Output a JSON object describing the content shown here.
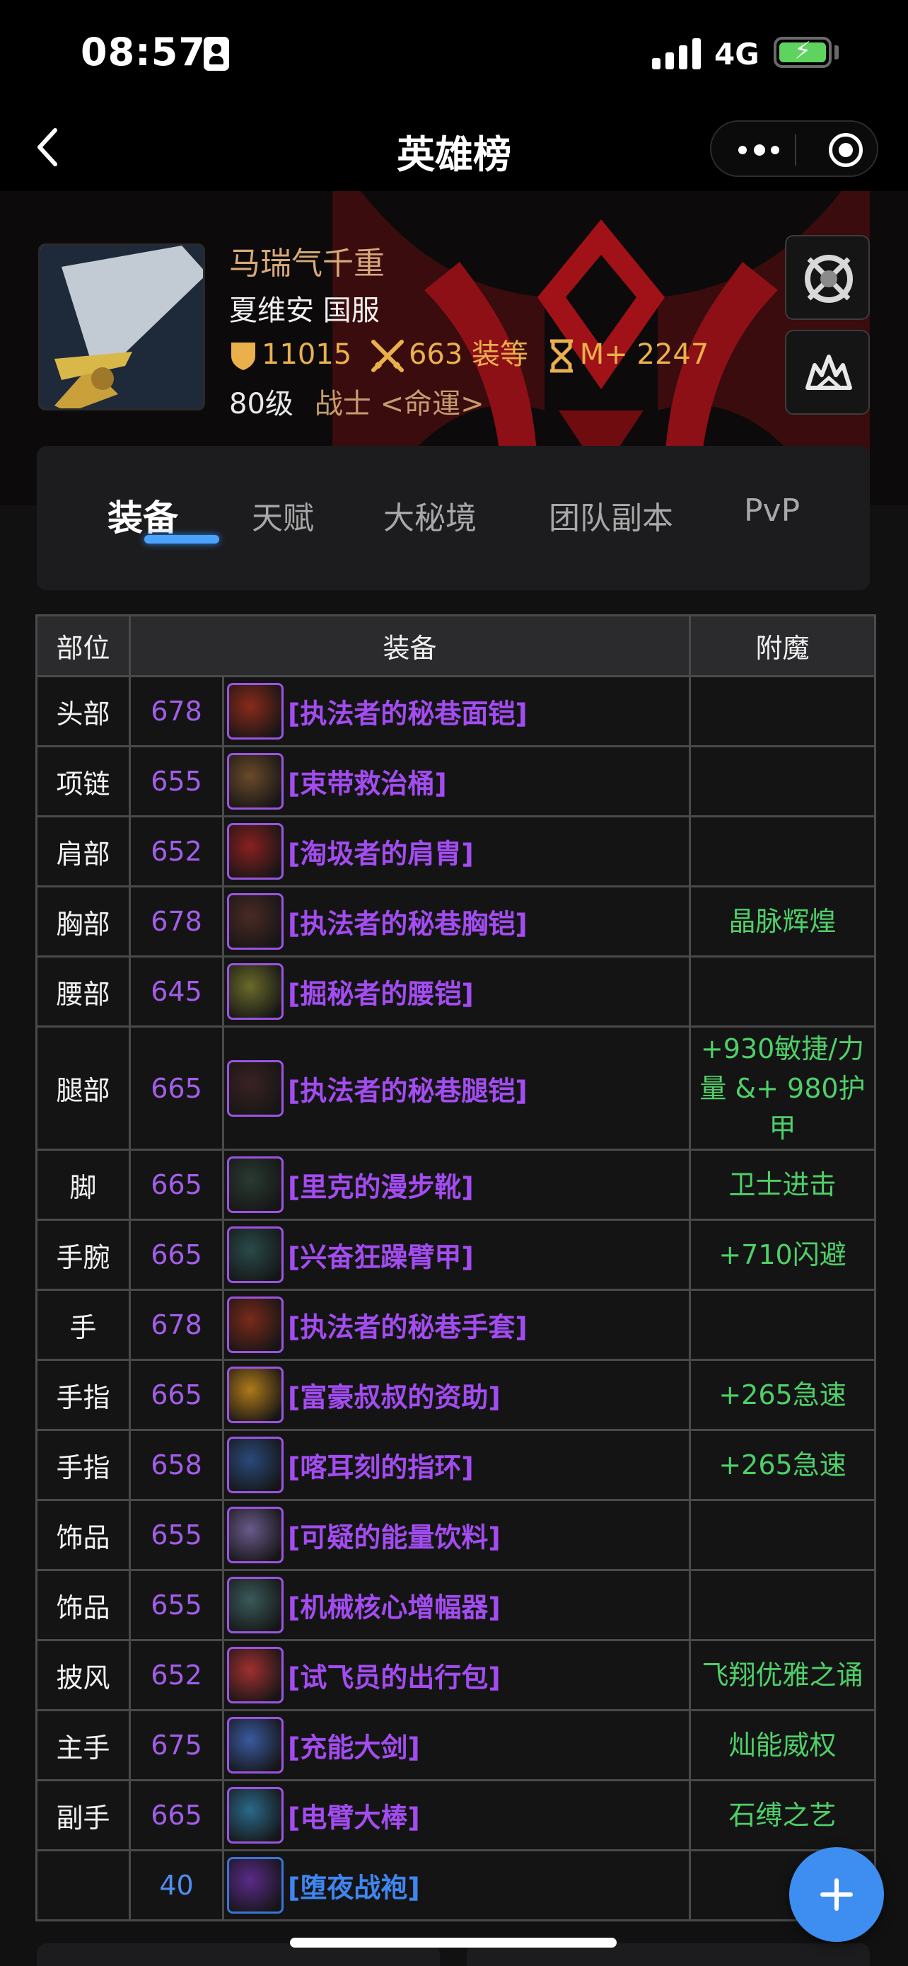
{
  "status_bar": {
    "time": "08:57",
    "network": "4G"
  },
  "nav": {
    "title": "英雄榜"
  },
  "profile": {
    "name": "马瑞气千重",
    "realm": "夏维安 国服",
    "achievement_points": "11015",
    "item_level": "663",
    "item_level_unit": "装等",
    "mythic_plus": "M+ 2247",
    "level": "80级",
    "class_guild": "战士 <命運>"
  },
  "tabs": [
    {
      "label": "装备",
      "active": true
    },
    {
      "label": "天赋",
      "active": false
    },
    {
      "label": "大秘境",
      "active": false
    },
    {
      "label": "团队副本",
      "active": false
    },
    {
      "label": "PvP",
      "active": false
    }
  ],
  "equipment": {
    "headers": {
      "slot": "部位",
      "item": "装备",
      "enchant": "附魔"
    },
    "rows": [
      {
        "slot": "头部",
        "ilvl": "678",
        "name": "[执法者的秘巷面铠]",
        "enchant": "",
        "quality": "epic",
        "icon_color": "#8a2a1a"
      },
      {
        "slot": "项链",
        "ilvl": "655",
        "name": "[束带救治桶]",
        "enchant": "",
        "quality": "epic",
        "icon_color": "#6a4a2a"
      },
      {
        "slot": "肩部",
        "ilvl": "652",
        "name": "[淘圾者的肩胄]",
        "enchant": "",
        "quality": "epic",
        "icon_color": "#8a2020"
      },
      {
        "slot": "胸部",
        "ilvl": "678",
        "name": "[执法者的秘巷胸铠]",
        "enchant": "晶脉辉煌",
        "quality": "epic",
        "icon_color": "#4a2a24"
      },
      {
        "slot": "腰部",
        "ilvl": "645",
        "name": "[掘秘者的腰铠]",
        "enchant": "",
        "quality": "epic",
        "icon_color": "#6a6a2a"
      },
      {
        "slot": "腿部",
        "ilvl": "665",
        "name": "[执法者的秘巷腿铠]",
        "enchant": "+930敏捷/力量 &+ 980护甲",
        "quality": "epic",
        "icon_color": "#3a2222"
      },
      {
        "slot": "脚",
        "ilvl": "665",
        "name": "[里克的漫步靴]",
        "enchant": "卫士进击",
        "quality": "epic",
        "icon_color": "#2a3a32"
      },
      {
        "slot": "手腕",
        "ilvl": "665",
        "name": "[兴奋狂躁臂甲]",
        "enchant": "+710闪避",
        "quality": "epic",
        "icon_color": "#2a4a4a"
      },
      {
        "slot": "手",
        "ilvl": "678",
        "name": "[执法者的秘巷手套]",
        "enchant": "",
        "quality": "epic",
        "icon_color": "#7a2a1a"
      },
      {
        "slot": "手指",
        "ilvl": "665",
        "name": "[富豪叔叔的资助]",
        "enchant": "+265急速",
        "quality": "epic",
        "icon_color": "#b07a1a"
      },
      {
        "slot": "手指",
        "ilvl": "658",
        "name": "[喀耳刻的指环]",
        "enchant": "+265急速",
        "quality": "epic",
        "icon_color": "#2a4a7a"
      },
      {
        "slot": "饰品",
        "ilvl": "655",
        "name": "[可疑的能量饮料]",
        "enchant": "",
        "quality": "epic",
        "icon_color": "#6a5a8a"
      },
      {
        "slot": "饰品",
        "ilvl": "655",
        "name": "[机械核心增幅器]",
        "enchant": "",
        "quality": "epic",
        "icon_color": "#3a5a5a"
      },
      {
        "slot": "披风",
        "ilvl": "652",
        "name": "[试飞员的出行包]",
        "enchant": "飞翔优雅之诵",
        "quality": "epic",
        "icon_color": "#a03030"
      },
      {
        "slot": "主手",
        "ilvl": "675",
        "name": "[充能大剑]",
        "enchant": "灿能威权",
        "quality": "epic",
        "icon_color": "#3a5aa0"
      },
      {
        "slot": "副手",
        "ilvl": "665",
        "name": "[电臂大棒]",
        "enchant": "石缚之艺",
        "quality": "epic",
        "icon_color": "#2a6a8a"
      },
      {
        "slot": "",
        "ilvl": "40",
        "name": "[堕夜战袍]",
        "enchant": "",
        "quality": "rare",
        "icon_color": "#5a2a8a"
      }
    ]
  },
  "colors": {
    "accent": "#4aa4ff",
    "epic": "#a34cf0",
    "rare": "#3f86f0",
    "enchant": "#4fcf68",
    "gold": "#e9b04c",
    "name": "#d7a878"
  }
}
